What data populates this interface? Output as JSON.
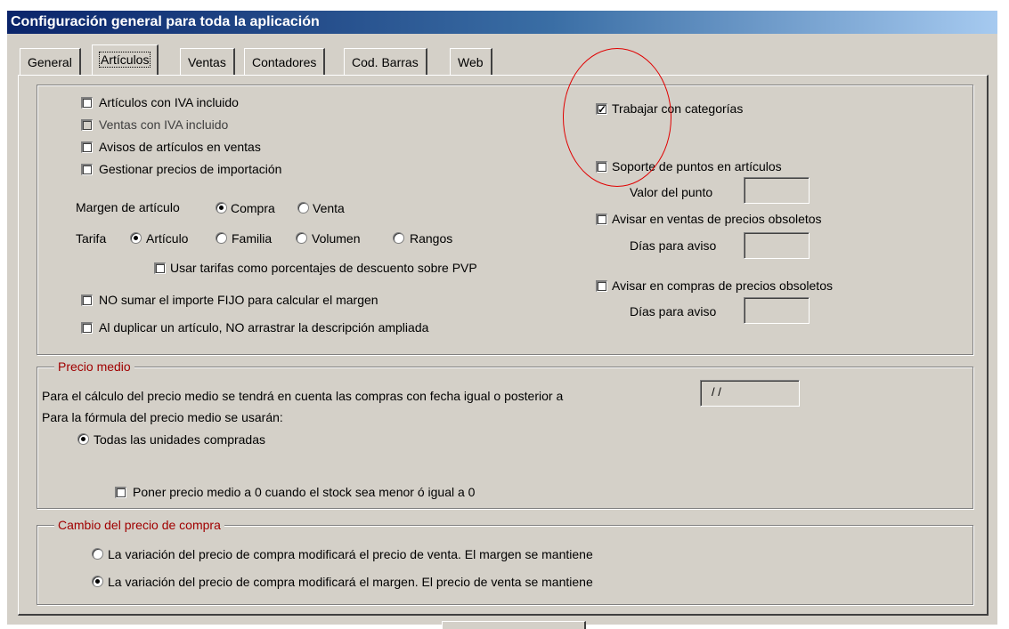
{
  "window": {
    "title": "Configuración general para toda la aplicación"
  },
  "tabs": [
    "General",
    "Artículos",
    "Ventas",
    "Contadores",
    "Cod. Barras",
    "Web"
  ],
  "articulos": {
    "left_checks": [
      {
        "label": "Artículos con IVA incluido",
        "checked": false
      },
      {
        "label": "Ventas con IVA incluido",
        "checked": false,
        "disabled": true
      },
      {
        "label": "Avisos de artículos en ventas",
        "checked": false
      },
      {
        "label": "Gestionar precios de importación",
        "checked": false
      }
    ],
    "margen_label": "Margen de artículo",
    "margen_options": [
      {
        "label": "Compra",
        "selected": true
      },
      {
        "label": "Venta",
        "selected": false
      }
    ],
    "tarifa_label": "Tarifa",
    "tarifa_options": [
      {
        "label": "Artículo",
        "selected": true
      },
      {
        "label": "Familia",
        "selected": false
      },
      {
        "label": "Volumen",
        "selected": false
      },
      {
        "label": "Rangos",
        "selected": false
      }
    ],
    "usar_tarifas": "Usar tarifas como porcentajes de descuento sobre PVP",
    "no_sumar": "NO sumar el importe FIJO para calcular el margen",
    "al_duplicar": "Al duplicar un artículo, NO arrastrar la descripción ampliada",
    "trabajar_categorias": {
      "label": "Trabajar con categorías",
      "checked": true
    },
    "soporte_puntos": "Soporte de puntos en artículos",
    "valor_punto_label": "Valor del punto",
    "avisar_ventas": "Avisar en ventas de precios obsoletos",
    "dias_aviso_label_1": "Días para aviso",
    "avisar_compras": "Avisar en compras de precios obsoletos",
    "dias_aviso_label_2": "Días para aviso"
  },
  "precio_medio": {
    "legend": "Precio medio",
    "calculo_text": "Para el cálculo del precio medio se tendrá en cuenta las compras con fecha igual o posterior a",
    "fecha_value": "/ /",
    "formula_text": "Para la fórmula del precio medio se usarán:",
    "todas_unidades": "Todas las unidades compradas",
    "poner_cero": "Poner precio medio a 0 cuando el stock sea menor ó igual a 0"
  },
  "cambio_precio": {
    "legend": "Cambio del precio de compra",
    "option_venta": "La variación del precio de compra modificará el precio de venta.  El margen se mantiene",
    "option_margen": "La variación del precio de compra modificará el margen.  El precio de venta se mantiene",
    "selected": "margen"
  },
  "colors": {
    "title_bar": "#0a246a",
    "face": "#d4d0c8",
    "legend_text": "#a00000",
    "annotation_circle": "#e00000"
  },
  "icons": {
    "checkbox_checked": "check-mark-icon"
  }
}
